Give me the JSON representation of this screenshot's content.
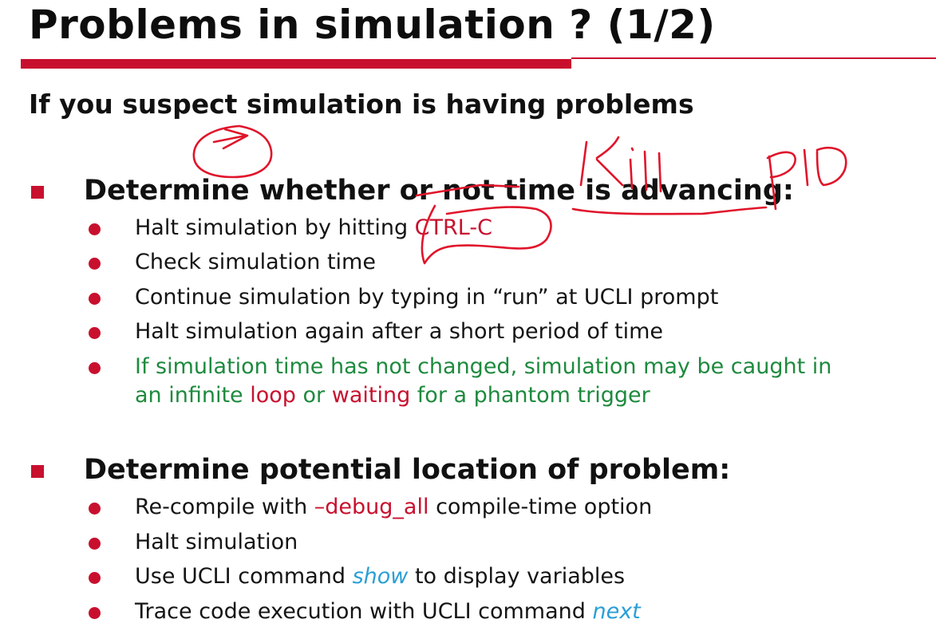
{
  "title": "Problems in simulation ? (1/2)",
  "subtitle": "If you suspect simulation is having problems",
  "sections": [
    {
      "heading": "Determine whether or not time is advancing:",
      "items": [
        {
          "before": "Halt simulation by hitting ",
          "highlight": "CTRL-C",
          "after": ""
        },
        {
          "text": "Check simulation time"
        },
        {
          "text": "Continue simulation by typing in “run” at UCLI prompt"
        },
        {
          "text": "Halt simulation again after a short period of time"
        },
        {
          "line1": "If simulation time has not changed, simulation may be caught in",
          "line2_a": "an infinite ",
          "line2_loop": "loop",
          "line2_b": " or ",
          "line2_waiting": "waiting",
          "line2_c": " for a phantom trigger"
        }
      ]
    },
    {
      "heading": "Determine potential location of problem:",
      "items": [
        {
          "before": "Re-compile with ",
          "highlight": "–debug_all",
          "after": " compile-time option"
        },
        {
          "text": "Halt simulation"
        },
        {
          "before": "Use UCLI command ",
          "highlight": "show",
          "after": " to display variables"
        },
        {
          "before": "Trace code execution with UCLI command ",
          "highlight": "next",
          "after": ""
        }
      ]
    }
  ],
  "annotations": {
    "handwriting_kill": "Kill",
    "handwriting_pid": "PID"
  },
  "colors": {
    "accent": "#c8102e",
    "green_text": "#1e8a3e",
    "blue_italic": "#2a9fd6",
    "ink": "#e0142a"
  }
}
